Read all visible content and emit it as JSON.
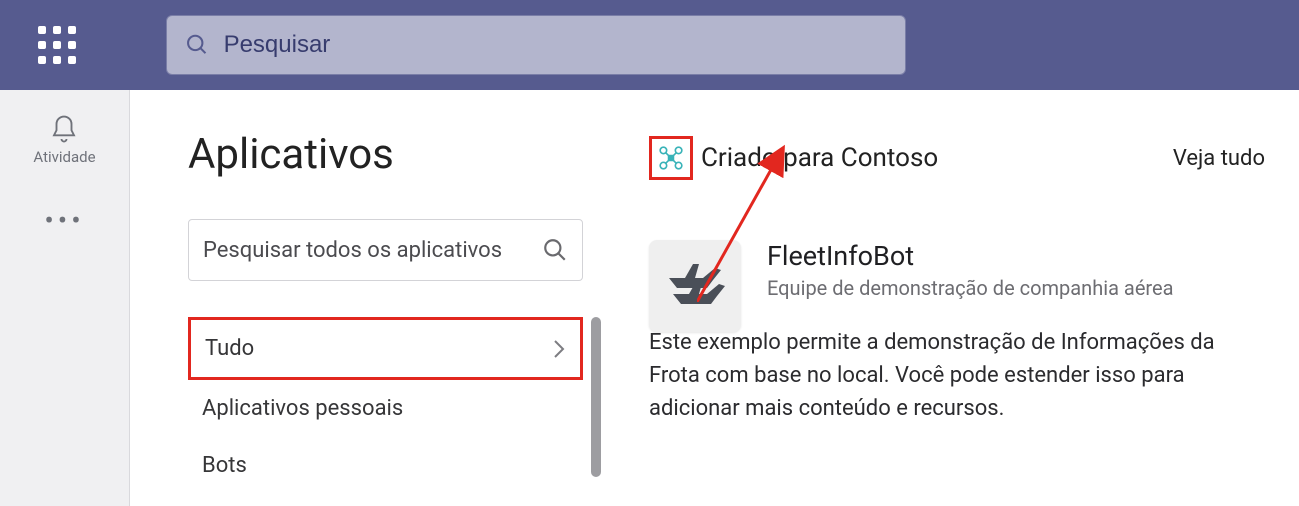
{
  "topbar": {
    "search_placeholder": "Pesquisar"
  },
  "rail": {
    "activity_label": "Atividade"
  },
  "apps": {
    "page_title": "Aplicativos",
    "search_placeholder": "Pesquisar todos os aplicativos",
    "categories": {
      "all": "Tudo",
      "personal": "Aplicativos pessoais",
      "bots": "Bots"
    }
  },
  "section": {
    "title": "Criado para Contoso",
    "see_all": "Veja tudo"
  },
  "app_card": {
    "name": "FleetInfoBot",
    "subtitle": "Equipe de demonstração de companhia aérea",
    "description": "Este exemplo permite a demonstração de Informações da Frota com base no local. Você pode estender isso para adicionar mais conteúdo e recursos."
  },
  "annotation": {
    "highlight_color": "#e2271f"
  }
}
